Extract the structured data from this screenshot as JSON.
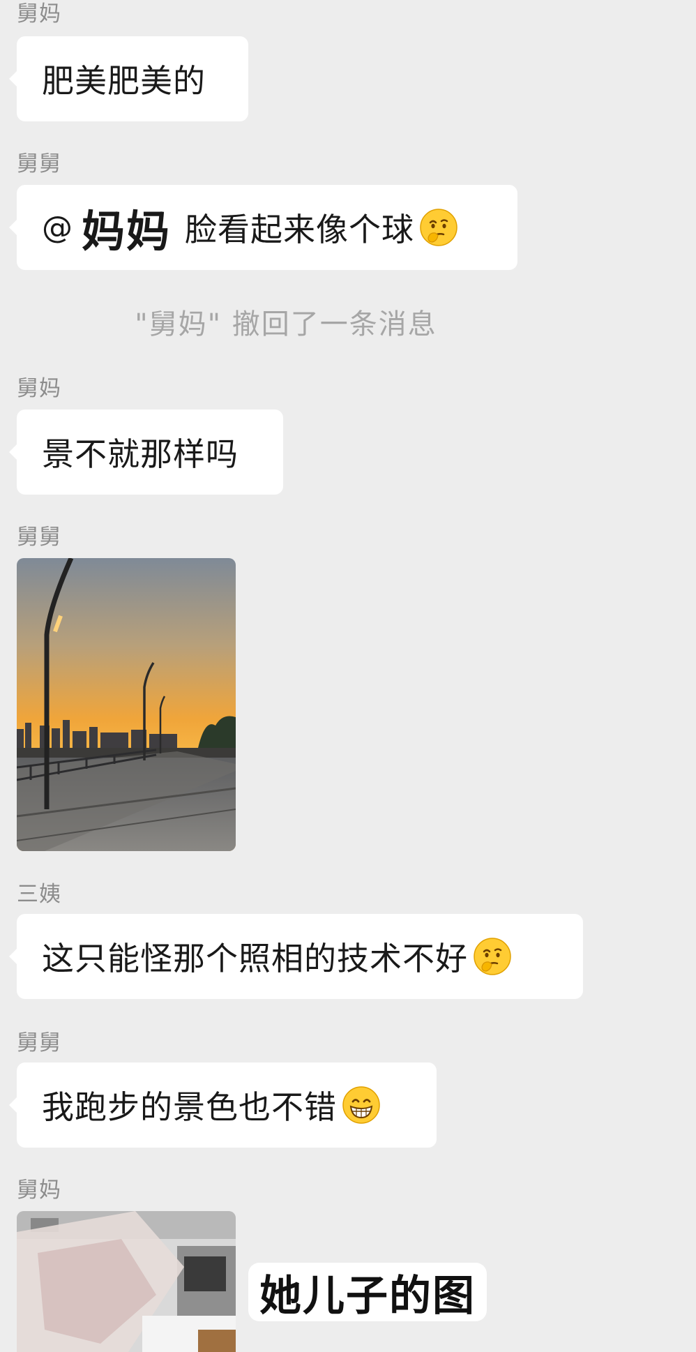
{
  "messages": [
    {
      "sender": "舅妈",
      "text": "肥美肥美的"
    },
    {
      "sender": "舅舅",
      "mention_at": "@",
      "mention_name": "妈妈",
      "text": "脸看起来像个球",
      "emoji": "thinking-face-emoji"
    },
    {
      "system": "\"舅妈\" 撤回了一条消息"
    },
    {
      "sender": "舅妈",
      "text": "景不就那样吗"
    },
    {
      "sender": "舅舅",
      "image": "sunset-riverside-walkway-photo"
    },
    {
      "sender": "三姨",
      "text": "这只能怪那个照相的技术不好",
      "emoji": "thinking-face-emoji"
    },
    {
      "sender": "舅舅",
      "text": "我跑步的景色也不错",
      "emoji": "grinning-face-emoji"
    },
    {
      "sender": "舅妈",
      "image": "blurred-interior-photo",
      "caption": "她儿子的图"
    }
  ],
  "colors": {
    "background": "#ededed",
    "bubble": "#ffffff",
    "sender_text": "#8c8c8c",
    "system_text": "#a6a6a6"
  }
}
